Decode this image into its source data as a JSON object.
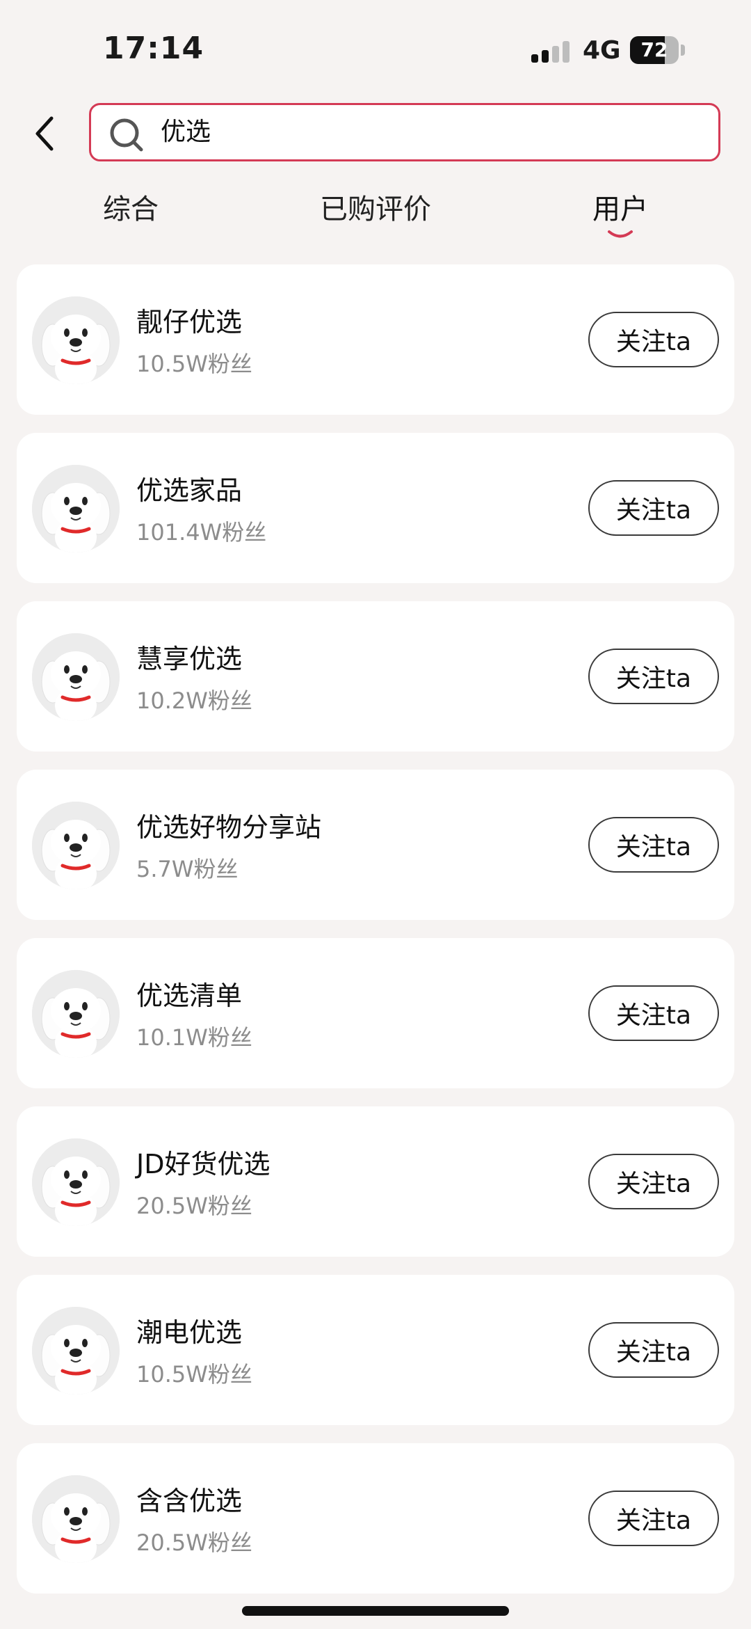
{
  "status_bar": {
    "time": "17:14",
    "network": "4G",
    "battery": "72",
    "battery_level": 0.72
  },
  "search": {
    "query": "优选"
  },
  "tabs": [
    {
      "label": "综合",
      "active": false
    },
    {
      "label": "已购评价",
      "active": false
    },
    {
      "label": "用户",
      "active": true
    }
  ],
  "colors": {
    "accent": "#d43a55",
    "background": "#f6f3f2",
    "muted_text": "#8c8c8c"
  },
  "icons": {
    "back": "chevron-left-icon",
    "search": "search-icon",
    "avatar": "jd-dog-mascot"
  },
  "users": [
    {
      "name": "靓仔优选",
      "fans": "10.5W粉丝",
      "follow_label": "关注ta"
    },
    {
      "name": "优选家品",
      "fans": "101.4W粉丝",
      "follow_label": "关注ta"
    },
    {
      "name": "慧享优选",
      "fans": "10.2W粉丝",
      "follow_label": "关注ta"
    },
    {
      "name": "优选好物分享站",
      "fans": "5.7W粉丝",
      "follow_label": "关注ta"
    },
    {
      "name": "优选清单",
      "fans": "10.1W粉丝",
      "follow_label": "关注ta"
    },
    {
      "name": "JD好货优选",
      "fans": "20.5W粉丝",
      "follow_label": "关注ta"
    },
    {
      "name": "潮电优选",
      "fans": "10.5W粉丝",
      "follow_label": "关注ta"
    },
    {
      "name": "含含优选",
      "fans": "20.5W粉丝",
      "follow_label": "关注ta"
    }
  ]
}
